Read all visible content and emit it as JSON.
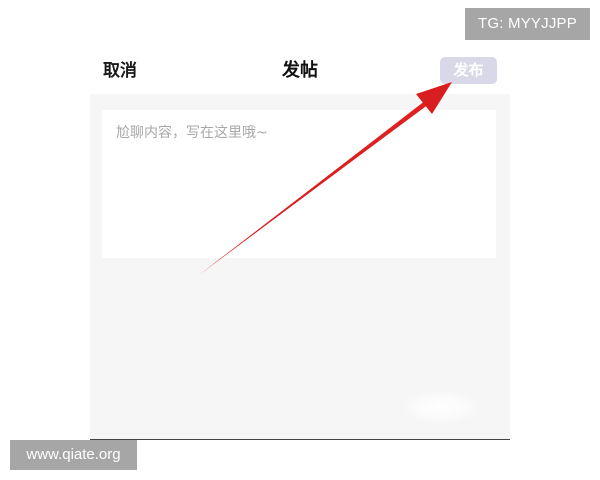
{
  "watermarks": {
    "top": "TG: MYYJJPP",
    "bottom": "www.qiate.org"
  },
  "header": {
    "cancel_label": "取消",
    "title": "发帖",
    "publish_label": "发布"
  },
  "editor": {
    "placeholder": "尬聊内容，写在这里哦~",
    "value": ""
  },
  "colors": {
    "publish_button_bg": "#d8d8e8",
    "content_bg": "#f6f6f6",
    "arrow": "#d81e1e"
  }
}
